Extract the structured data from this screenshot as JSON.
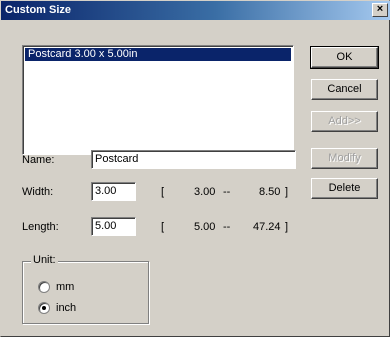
{
  "window": {
    "title": "Custom Size",
    "close_glyph": "×"
  },
  "list": {
    "items": [
      "Postcard 3.00 x 5.00in"
    ]
  },
  "buttons": {
    "ok": "OK",
    "cancel": "Cancel",
    "add": "Add>>",
    "modify": "Modify",
    "delete": "Delete"
  },
  "fields": {
    "name_label": "Name:",
    "name_value": "Postcard",
    "width_label": "Width:",
    "width_value": "3.00",
    "width_min": "3.00",
    "width_max": "8.50",
    "length_label": "Length:",
    "length_value": "5.00",
    "length_min": "5.00",
    "length_max": "47.24",
    "range_open": "[",
    "range_sep": "--",
    "range_close": "]"
  },
  "unit": {
    "label": "Unit:",
    "options": [
      "mm",
      "inch"
    ],
    "selected": "inch"
  }
}
